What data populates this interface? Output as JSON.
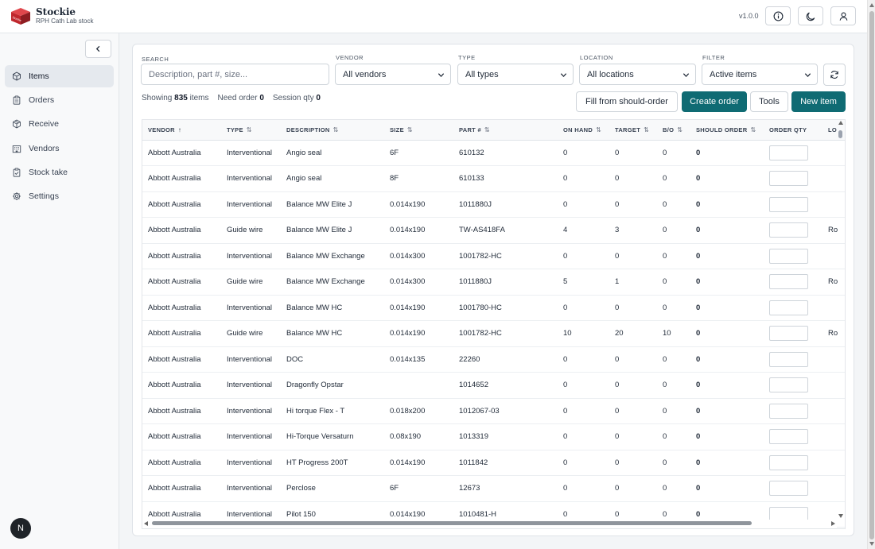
{
  "app": {
    "name": "Stockie",
    "subtitle": "RPH Cath Lab stock",
    "logo_text": "Stockie",
    "version": "v1.0.0",
    "header_icons": [
      "info-icon",
      "moon-icon",
      "user-icon"
    ]
  },
  "sidebar": {
    "items": [
      {
        "label": "Items",
        "icon": "box-icon",
        "active": true
      },
      {
        "label": "Orders",
        "icon": "clipboard-icon",
        "active": false
      },
      {
        "label": "Receive",
        "icon": "package-icon",
        "active": false
      },
      {
        "label": "Vendors",
        "icon": "building-icon",
        "active": false
      },
      {
        "label": "Stock take",
        "icon": "clipboard-check-icon",
        "active": false
      },
      {
        "label": "Settings",
        "icon": "gear-icon",
        "active": false
      }
    ],
    "avatar_initial": "N"
  },
  "filters": {
    "search_label": "SEARCH",
    "search_placeholder": "Description, part #, size...",
    "vendor_label": "VENDOR",
    "vendor_value": "All vendors",
    "type_label": "TYPE",
    "type_value": "All types",
    "location_label": "LOCATION",
    "location_value": "All locations",
    "filter_label": "FILTER",
    "filter_value": "Active items"
  },
  "stats": {
    "showing_label": "Showing",
    "showing_count": "835",
    "showing_suffix": "items",
    "need_order_label": "Need order",
    "need_order_value": "0",
    "session_qty_label": "Session qty",
    "session_qty_value": "0"
  },
  "actions": {
    "fill_label": "Fill from should-order",
    "create_label": "Create order",
    "tools_label": "Tools",
    "new_label": "New item"
  },
  "colors": {
    "primary": "#0f6b73",
    "logo_red": "#c0272d"
  },
  "table": {
    "columns": [
      "VENDOR",
      "TYPE",
      "DESCRIPTION",
      "SIZE",
      "PART #",
      "ON HAND",
      "TARGET",
      "B/O",
      "SHOULD ORDER",
      "ORDER QTY",
      "LO"
    ],
    "sort_arrows": [
      "↑",
      "⇅",
      "⇅",
      "⇅",
      "⇅",
      "⇅",
      "⇅",
      "⇅",
      "⇅",
      "",
      ""
    ],
    "rows": [
      [
        "Abbott Australia",
        "Interventional",
        "Angio seal",
        "6F",
        "610132",
        "0",
        "0",
        "0",
        "0",
        ""
      ],
      [
        "Abbott Australia",
        "Interventional",
        "Angio seal",
        "8F",
        "610133",
        "0",
        "0",
        "0",
        "0",
        ""
      ],
      [
        "Abbott Australia",
        "Interventional",
        "Balance MW Elite J",
        "0.014x190",
        "1011880J",
        "0",
        "0",
        "0",
        "0",
        ""
      ],
      [
        "Abbott Australia",
        "Guide wire",
        "Balance MW Elite J",
        "0.014x190",
        "TW-AS418FA",
        "4",
        "3",
        "0",
        "0",
        "Ro"
      ],
      [
        "Abbott Australia",
        "Interventional",
        "Balance MW Exchange",
        "0.014x300",
        "1001782-HC",
        "0",
        "0",
        "0",
        "0",
        ""
      ],
      [
        "Abbott Australia",
        "Guide wire",
        "Balance MW Exchange",
        "0.014x300",
        "1011880J",
        "5",
        "1",
        "0",
        "0",
        "Ro"
      ],
      [
        "Abbott Australia",
        "Interventional",
        "Balance MW HC",
        "0.014x190",
        "1001780-HC",
        "0",
        "0",
        "0",
        "0",
        ""
      ],
      [
        "Abbott Australia",
        "Guide wire",
        "Balance MW HC",
        "0.014x190",
        "1001782-HC",
        "10",
        "20",
        "10",
        "0",
        "Ro"
      ],
      [
        "Abbott Australia",
        "Interventional",
        "DOC",
        "0.014x135",
        "22260",
        "0",
        "0",
        "0",
        "0",
        ""
      ],
      [
        "Abbott Australia",
        "Interventional",
        "Dragonfly Opstar",
        "",
        "1014652",
        "0",
        "0",
        "0",
        "0",
        ""
      ],
      [
        "Abbott Australia",
        "Interventional",
        "Hi torque Flex - T",
        "0.018x200",
        "1012067-03",
        "0",
        "0",
        "0",
        "0",
        ""
      ],
      [
        "Abbott Australia",
        "Interventional",
        "Hi-Torque Versaturn",
        "0.08x190",
        "1013319",
        "0",
        "0",
        "0",
        "0",
        ""
      ],
      [
        "Abbott Australia",
        "Interventional",
        "HT Progress 200T",
        "0.014x190",
        "1011842",
        "0",
        "0",
        "0",
        "0",
        ""
      ],
      [
        "Abbott Australia",
        "Interventional",
        "Perclose",
        "6F",
        "12673",
        "0",
        "0",
        "0",
        "0",
        ""
      ],
      [
        "Abbott Australia",
        "Interventional",
        "Pilot 150",
        "0.014x190",
        "1010481-H",
        "0",
        "0",
        "0",
        "0",
        ""
      ]
    ]
  }
}
